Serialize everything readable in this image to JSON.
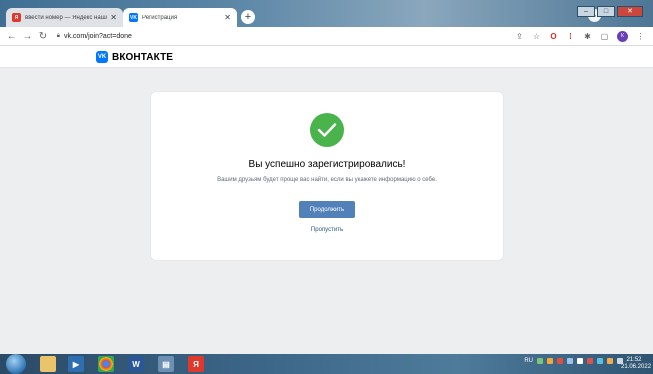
{
  "browser": {
    "tabs": [
      {
        "title": "ввести номер — Яндекс нашл",
        "favicon": "yandex-icon",
        "active": false
      },
      {
        "title": "Регистрация",
        "favicon": "vk-icon",
        "active": true
      }
    ],
    "url": "vk.com/join?act=done",
    "profile_letter": "К"
  },
  "vk": {
    "brand": "ВКОНТАКТЕ",
    "logo_letters": "VK",
    "title": "Вы успешно зарегистрировались!",
    "description": "Вашим друзьям будет проще вас найти, если вы укажете информацию о себе.",
    "continue_label": "Продолжить",
    "skip_label": "Пропустить"
  },
  "taskbar": {
    "lang": "RU",
    "time": "21:52",
    "date": "21.06.2022"
  },
  "colors": {
    "accent": "#5181b8",
    "success": "#4bb34b",
    "vk_blue": "#0077ff"
  }
}
